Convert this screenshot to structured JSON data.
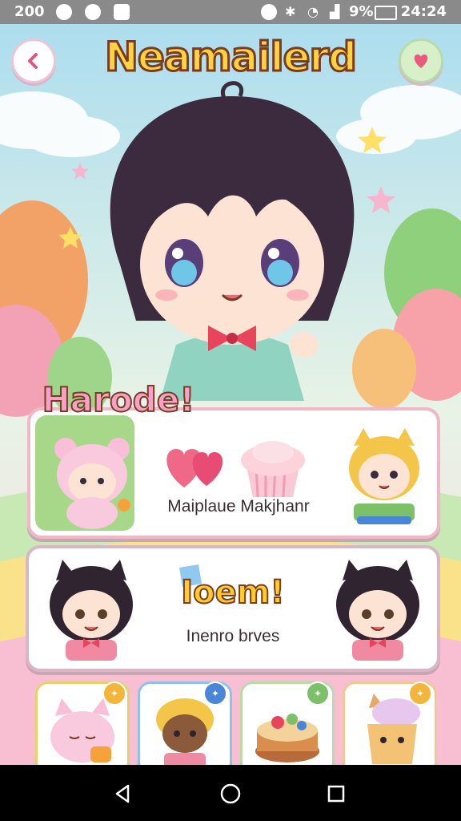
{
  "status_bar": {
    "left_text": "200",
    "battery_text": "9%",
    "time": "24:24"
  },
  "header": {
    "title": "Neamailerd",
    "back_icon": "chevron-left-icon",
    "right_icon": "heart-icon"
  },
  "section1": {
    "tag": "Harode!",
    "caption": "Maiplaue Makjhanr"
  },
  "section2": {
    "tag": "Ioem!",
    "caption": "Inenro brves"
  },
  "cards": [
    {
      "name": "pink-cat",
      "badge_color": "#f4b63a"
    },
    {
      "name": "blond-kid",
      "badge_color": "#4a86d8"
    },
    {
      "name": "cake",
      "badge_color": "#7cc06a"
    },
    {
      "name": "cat-cupcake",
      "badge_color": "#f4b63a"
    }
  ],
  "colors": {
    "sky": "#bfe4f3",
    "title_fill": "#ffd33d",
    "outline": "#7a3b24",
    "panel_border": "#f0b8c6"
  }
}
